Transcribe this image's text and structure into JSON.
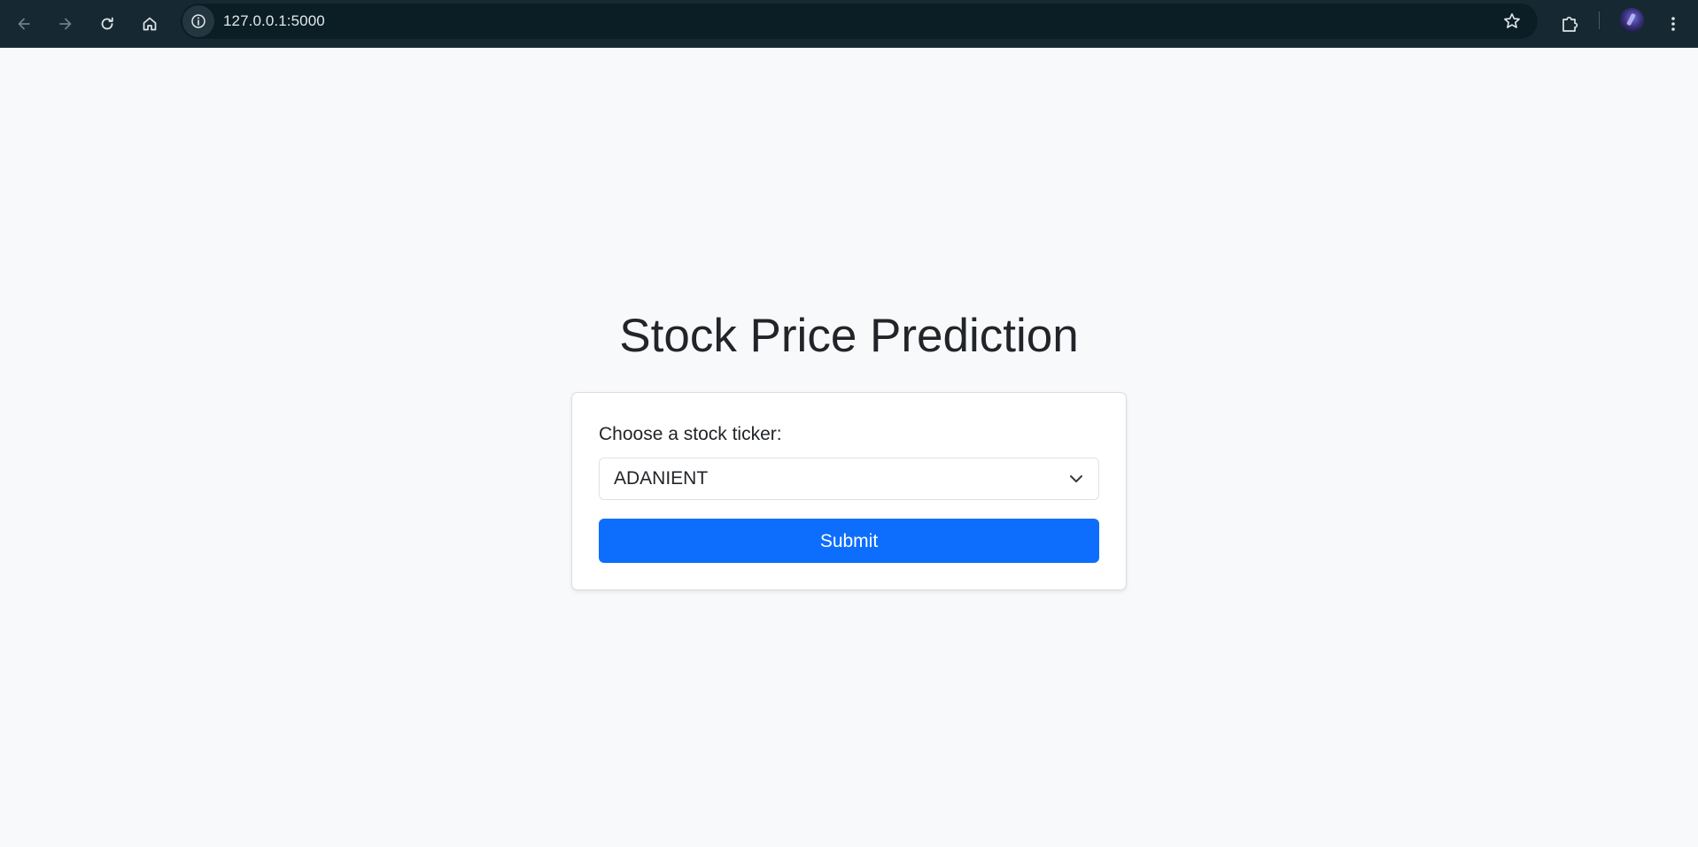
{
  "browser": {
    "url": "127.0.0.1:5000",
    "icons": {
      "back": "arrow-left-icon",
      "forward": "arrow-right-icon",
      "reload": "reload-icon",
      "home": "home-icon",
      "site_info": "info-icon",
      "bookmark": "star-icon",
      "extensions": "puzzle-icon",
      "menu": "more-vert-icon"
    },
    "colors": {
      "toolbar_bg": "#162932",
      "omnibox_bg": "#0b1e26"
    }
  },
  "page": {
    "title": "Stock Price Prediction",
    "form": {
      "label": "Choose a stock ticker:",
      "selected_ticker": "ADANIENT",
      "submit_label": "Submit"
    },
    "colors": {
      "background": "#f8f9fa",
      "primary": "#0d6efd",
      "text": "#212529"
    }
  }
}
